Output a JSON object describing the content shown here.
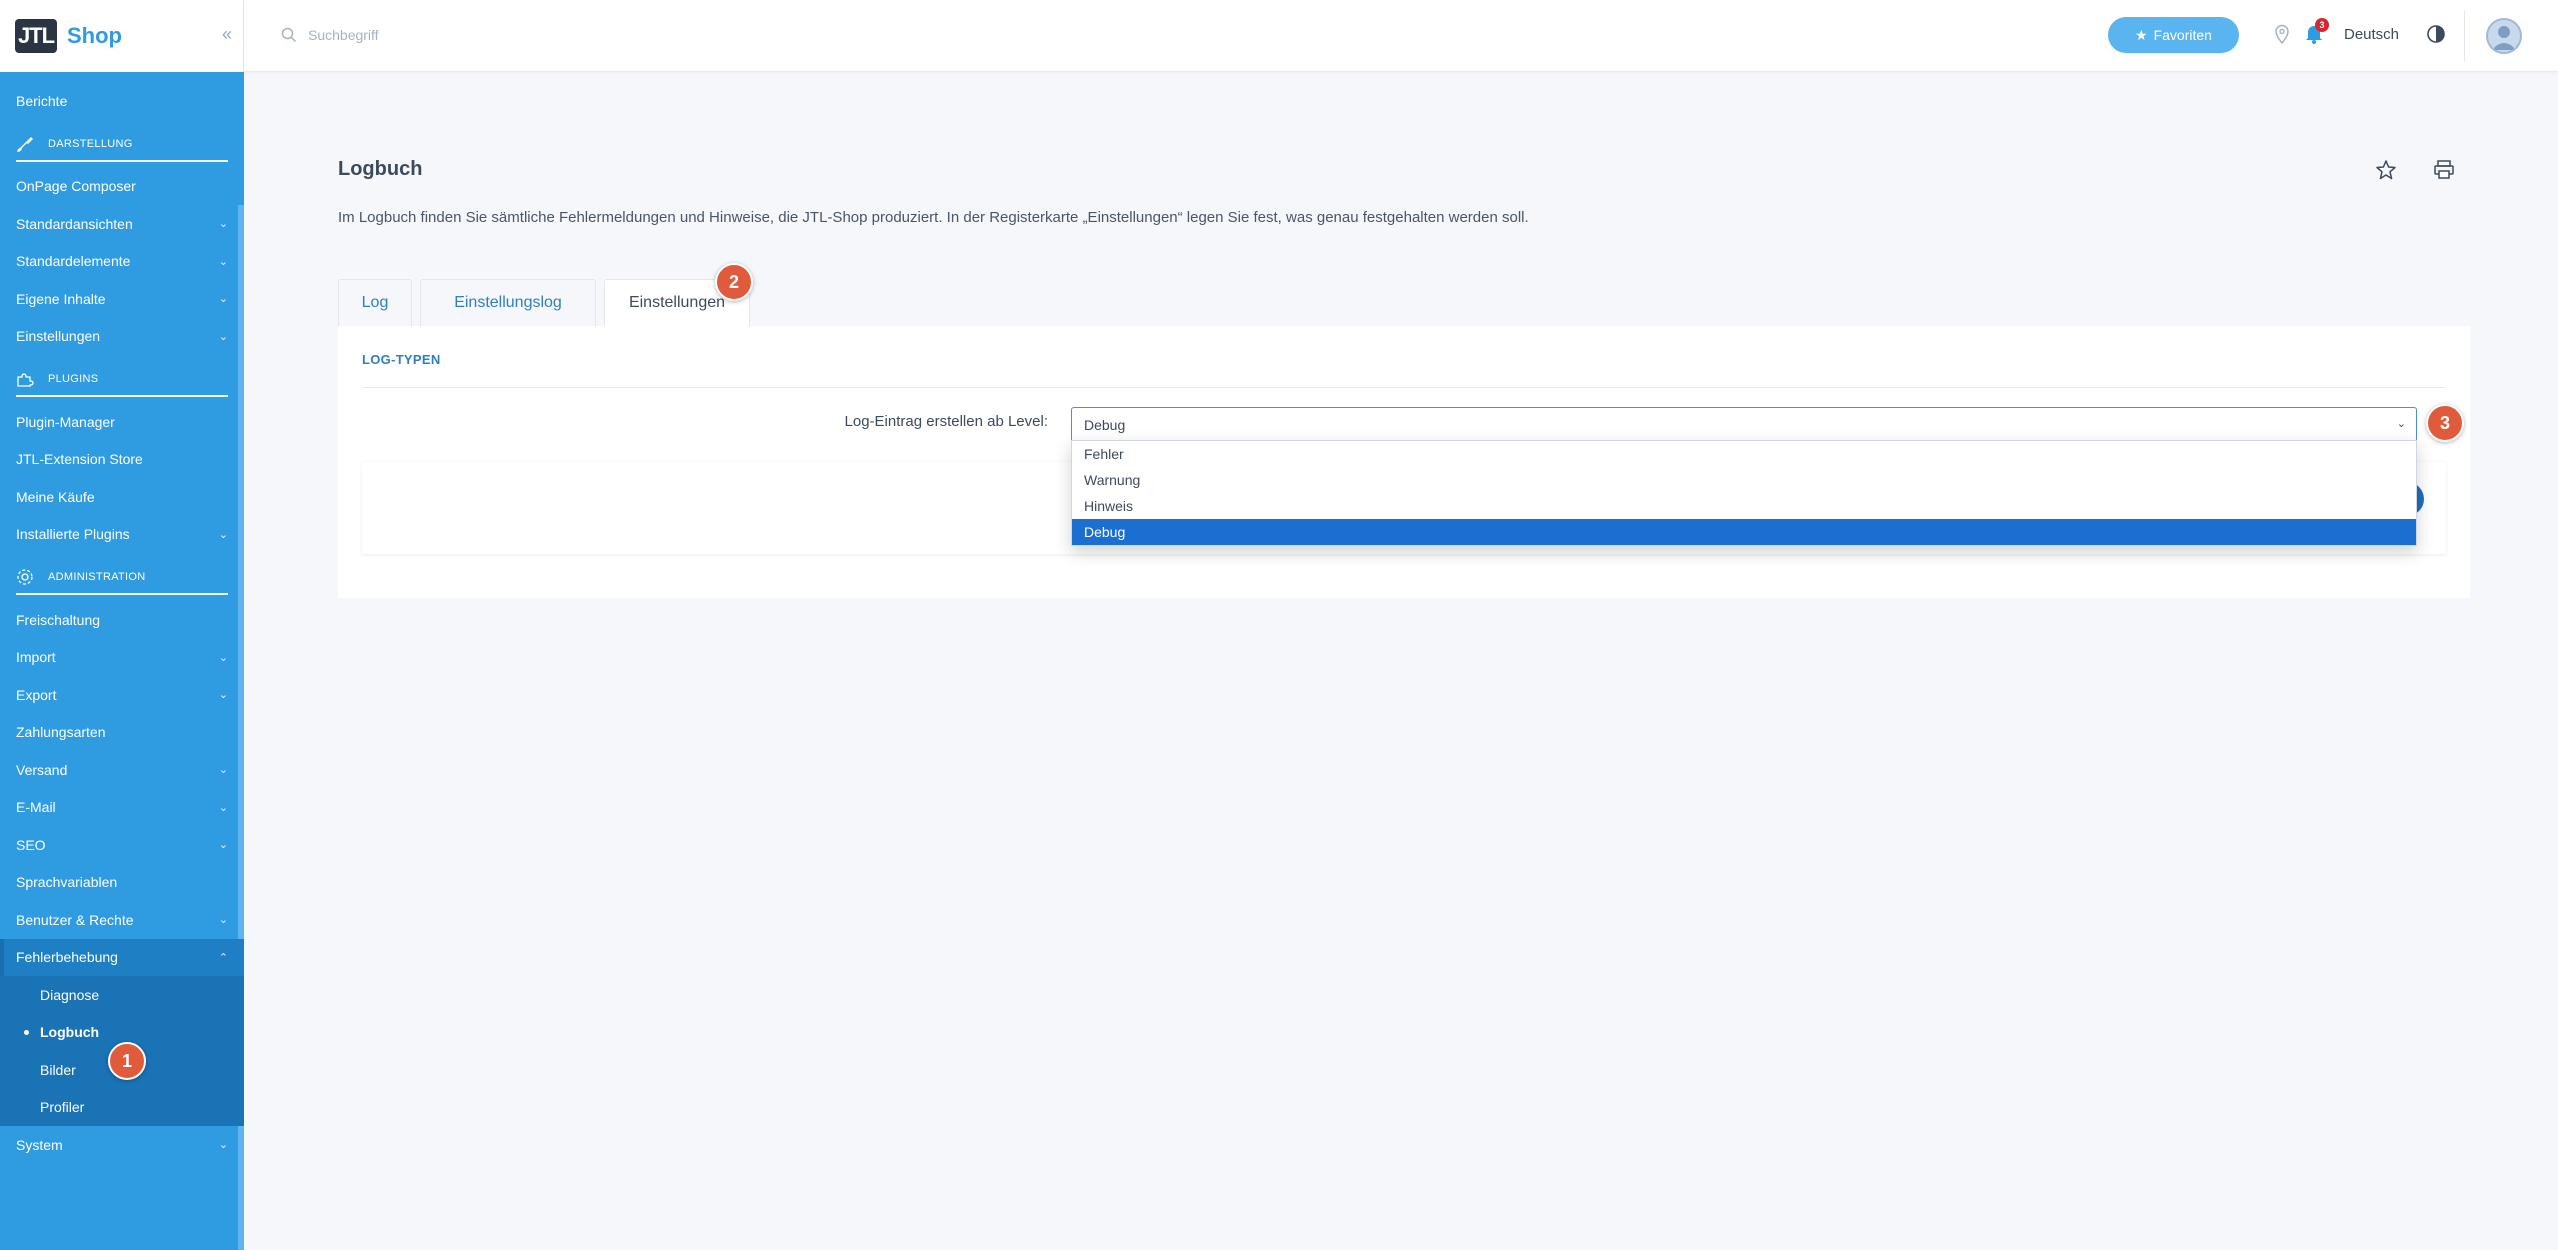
{
  "sidebar": {
    "brand": {
      "logo_text": "JTL",
      "name": "Shop"
    },
    "collapse_label": "«",
    "top_items": [
      {
        "label": "Berichte"
      }
    ],
    "sections": [
      {
        "title": "DARSTELLUNG",
        "icon": "brush-icon",
        "items": [
          {
            "label": "OnPage Composer",
            "expandable": false
          },
          {
            "label": "Standardansichten",
            "expandable": true
          },
          {
            "label": "Standardelemente",
            "expandable": true
          },
          {
            "label": "Eigene Inhalte",
            "expandable": true
          },
          {
            "label": "Einstellungen",
            "expandable": true
          }
        ]
      },
      {
        "title": "PLUGINS",
        "icon": "puzzle-icon",
        "items": [
          {
            "label": "Plugin-Manager",
            "expandable": false
          },
          {
            "label": "JTL-Extension Store",
            "expandable": false
          },
          {
            "label": "Meine Käufe",
            "expandable": false
          },
          {
            "label": "Installierte Plugins",
            "expandable": true
          }
        ]
      },
      {
        "title": "ADMINISTRATION",
        "icon": "gear-icon",
        "items": [
          {
            "label": "Freischaltung",
            "expandable": false
          },
          {
            "label": "Import",
            "expandable": true
          },
          {
            "label": "Export",
            "expandable": true
          },
          {
            "label": "Zahlungsarten",
            "expandable": false
          },
          {
            "label": "Versand",
            "expandable": true
          },
          {
            "label": "E-Mail",
            "expandable": true
          },
          {
            "label": "SEO",
            "expandable": true
          },
          {
            "label": "Sprachvariablen",
            "expandable": false
          },
          {
            "label": "Benutzer & Rechte",
            "expandable": true
          }
        ]
      }
    ],
    "active_group": {
      "label": "Fehlerbehebung",
      "children": [
        {
          "label": "Diagnose",
          "current": false
        },
        {
          "label": "Logbuch",
          "current": true
        },
        {
          "label": "Bilder",
          "current": false
        },
        {
          "label": "Profiler",
          "current": false
        }
      ]
    },
    "bottom_item": {
      "label": "System",
      "expandable": true
    }
  },
  "topbar": {
    "search_placeholder": "Suchbegriff",
    "favorites_label": "Favoriten",
    "notification_count": "3",
    "language": "Deutsch"
  },
  "main": {
    "title": "Logbuch",
    "description": "Im Logbuch finden Sie sämtliche Fehlermeldungen und Hinweise, die JTL-Shop produziert. In der Registerkarte „Einstellungen“ legen Sie fest, was genau festgehalten werden soll.",
    "tabs": [
      {
        "label": "Log",
        "active": false
      },
      {
        "label": "Einstellungslog",
        "active": false
      },
      {
        "label": "Einstellungen",
        "active": true
      }
    ],
    "section_title": "LOG-TYPEN",
    "field_label": "Log-Eintrag erstellen ab Level:",
    "select_value": "Debug",
    "options": [
      {
        "label": "Fehler",
        "selected": false
      },
      {
        "label": "Warnung",
        "selected": false
      },
      {
        "label": "Hinweis",
        "selected": false
      },
      {
        "label": "Debug",
        "selected": true
      }
    ]
  },
  "markers": [
    "1",
    "2",
    "3"
  ],
  "colors": {
    "sidebar_bg": "#2f9be0",
    "sidebar_active": "#1a73b5",
    "accent": "#2f7fc0",
    "favorites_bg": "#5ab4f0",
    "selected_option": "#1a6fd1",
    "marker": "#e05a3c",
    "badge": "#d9262c"
  }
}
